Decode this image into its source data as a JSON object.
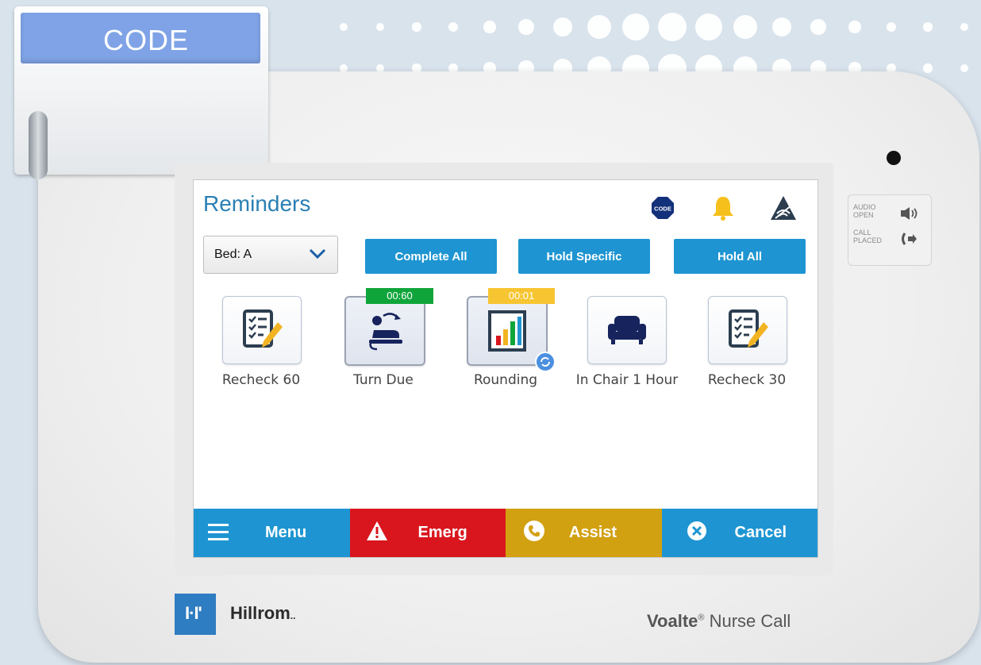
{
  "wall_button": {
    "label": "CODE"
  },
  "header": {
    "title": "Reminders"
  },
  "bed_select": {
    "label": "Bed: A"
  },
  "actions": {
    "complete_all": "Complete All",
    "hold_specific": "Hold Specific",
    "hold_all": "Hold All"
  },
  "reminders": [
    {
      "label": "Recheck 60",
      "icon": "checklist-pencil-icon"
    },
    {
      "label": "Turn Due",
      "icon": "turn-patient-icon",
      "timer": "00:60",
      "timer_color": "#10a53b"
    },
    {
      "label": "Rounding",
      "icon": "rounding-chart-icon",
      "timer": "00:01",
      "timer_color": "#f7c531"
    },
    {
      "label": "In Chair 1 Hour",
      "icon": "armchair-icon"
    },
    {
      "label": "Recheck 30",
      "icon": "checklist-pencil-icon"
    }
  ],
  "bottom_bar": {
    "menu": "Menu",
    "emerg": "Emerg",
    "assist": "Assist",
    "cancel": "Cancel",
    "colors": {
      "menu": "#1e95d2",
      "emerg": "#d9161e",
      "assist": "#d2a112",
      "cancel": "#1e95d2"
    }
  },
  "indicators": {
    "audio_open": "AUDIO OPEN",
    "call_placed": "CALL PLACED"
  },
  "brand": {
    "logo_mark": "I·I'",
    "name": "Hillrom",
    "product_name": "Voalte",
    "product_suffix": " Nurse Call"
  }
}
